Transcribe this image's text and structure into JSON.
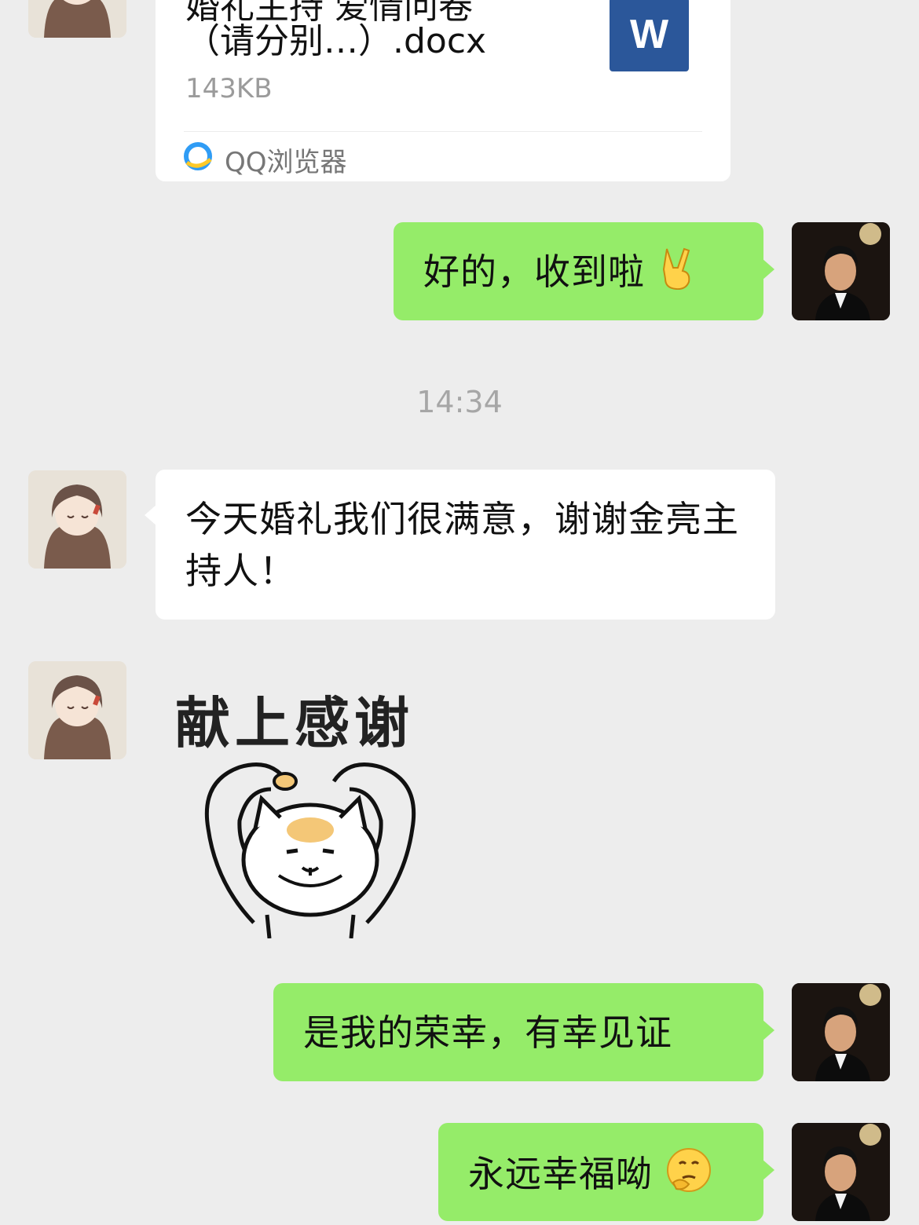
{
  "file_message": {
    "name_line1": "婚礼主持 爱情问卷",
    "name_line2": "（请分别…）.docx",
    "size": "143KB",
    "file_icon_letter": "W",
    "source_app": "QQ浏览器",
    "file_icon_color": "#2b579a"
  },
  "messages": {
    "reply1": "好的，收到啦",
    "reply1_emoji": "victory-hand-emoji",
    "timestamp": "14:34",
    "thanks": "今天婚礼我们很满意，谢谢金亮主持人！",
    "sticker_caption": "献上感谢",
    "sticker_icon": "cat-heart-sticker",
    "reply2": "是我的荣幸，有幸见证",
    "reply3": "永远幸福呦",
    "reply3_emoji": "thinking-face-emoji"
  },
  "colors": {
    "background": "#ededed",
    "outgoing_bubble": "#95ec69",
    "incoming_bubble": "#ffffff"
  }
}
